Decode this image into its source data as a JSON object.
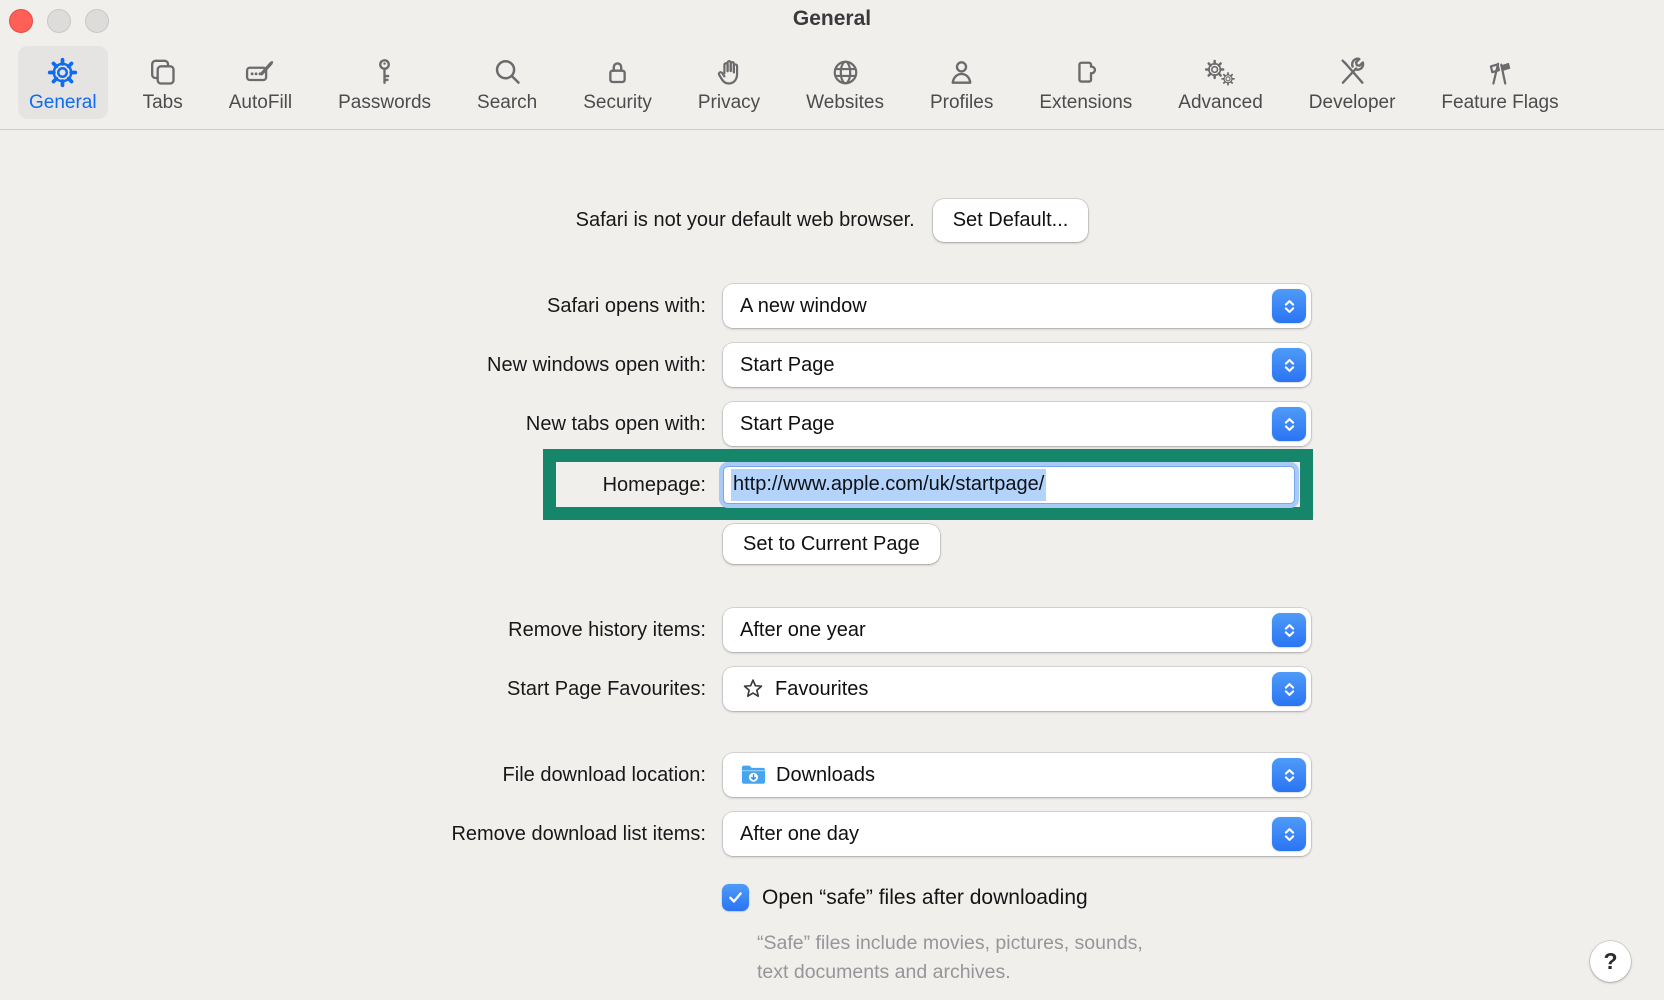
{
  "window": {
    "title": "General"
  },
  "toolbar": {
    "items": [
      {
        "label": "General",
        "icon": "gear-icon",
        "selected": true
      },
      {
        "label": "Tabs",
        "icon": "tabs-icon",
        "selected": false
      },
      {
        "label": "AutoFill",
        "icon": "autofill-icon",
        "selected": false
      },
      {
        "label": "Passwords",
        "icon": "key-icon",
        "selected": false
      },
      {
        "label": "Search",
        "icon": "magnifier-icon",
        "selected": false
      },
      {
        "label": "Security",
        "icon": "lock-icon",
        "selected": false
      },
      {
        "label": "Privacy",
        "icon": "hand-icon",
        "selected": false
      },
      {
        "label": "Websites",
        "icon": "globe-icon",
        "selected": false
      },
      {
        "label": "Profiles",
        "icon": "person-icon",
        "selected": false
      },
      {
        "label": "Extensions",
        "icon": "puzzle-icon",
        "selected": false
      },
      {
        "label": "Advanced",
        "icon": "gears-icon",
        "selected": false
      },
      {
        "label": "Developer",
        "icon": "tools-icon",
        "selected": false
      },
      {
        "label": "Feature Flags",
        "icon": "flags-icon",
        "selected": false
      }
    ]
  },
  "default_browser": {
    "status_text": "Safari is not your default web browser.",
    "button_label": "Set Default..."
  },
  "settings": {
    "safari_opens_with": {
      "label": "Safari opens with:",
      "value": "A new window"
    },
    "new_windows_open_with": {
      "label": "New windows open with:",
      "value": "Start Page"
    },
    "new_tabs_open_with": {
      "label": "New tabs open with:",
      "value": "Start Page"
    },
    "homepage": {
      "label": "Homepage:",
      "value": "http://www.apple.com/uk/startpage/",
      "text_selected": true
    },
    "set_to_current_page_label": "Set to Current Page",
    "remove_history_items": {
      "label": "Remove history items:",
      "value": "After one year"
    },
    "start_page_favourites": {
      "label": "Start Page Favourites:",
      "value": "Favourites",
      "icon": "star-icon"
    },
    "file_download_location": {
      "label": "File download location:",
      "value": "Downloads",
      "icon": "downloads-folder-icon"
    },
    "remove_download_list_items": {
      "label": "Remove download list items:",
      "value": "After one day"
    },
    "open_safe_files": {
      "label": "Open “safe” files after downloading",
      "checked": true,
      "description": [
        "“Safe” files include movies, pictures, sounds,",
        "text documents and archives."
      ]
    }
  },
  "help_button_label": "?",
  "annotation": {
    "type": "highlight-box",
    "color": "#16866C",
    "target": "homepage-row"
  },
  "colors": {
    "accent_blue": "#0f6bf0",
    "stepper_blue": "#2a74f3",
    "selection_blue": "#b3d3fb",
    "highlight_green": "#16866c",
    "window_background": "#f0efec",
    "traffic_red": "#ff5f57"
  }
}
